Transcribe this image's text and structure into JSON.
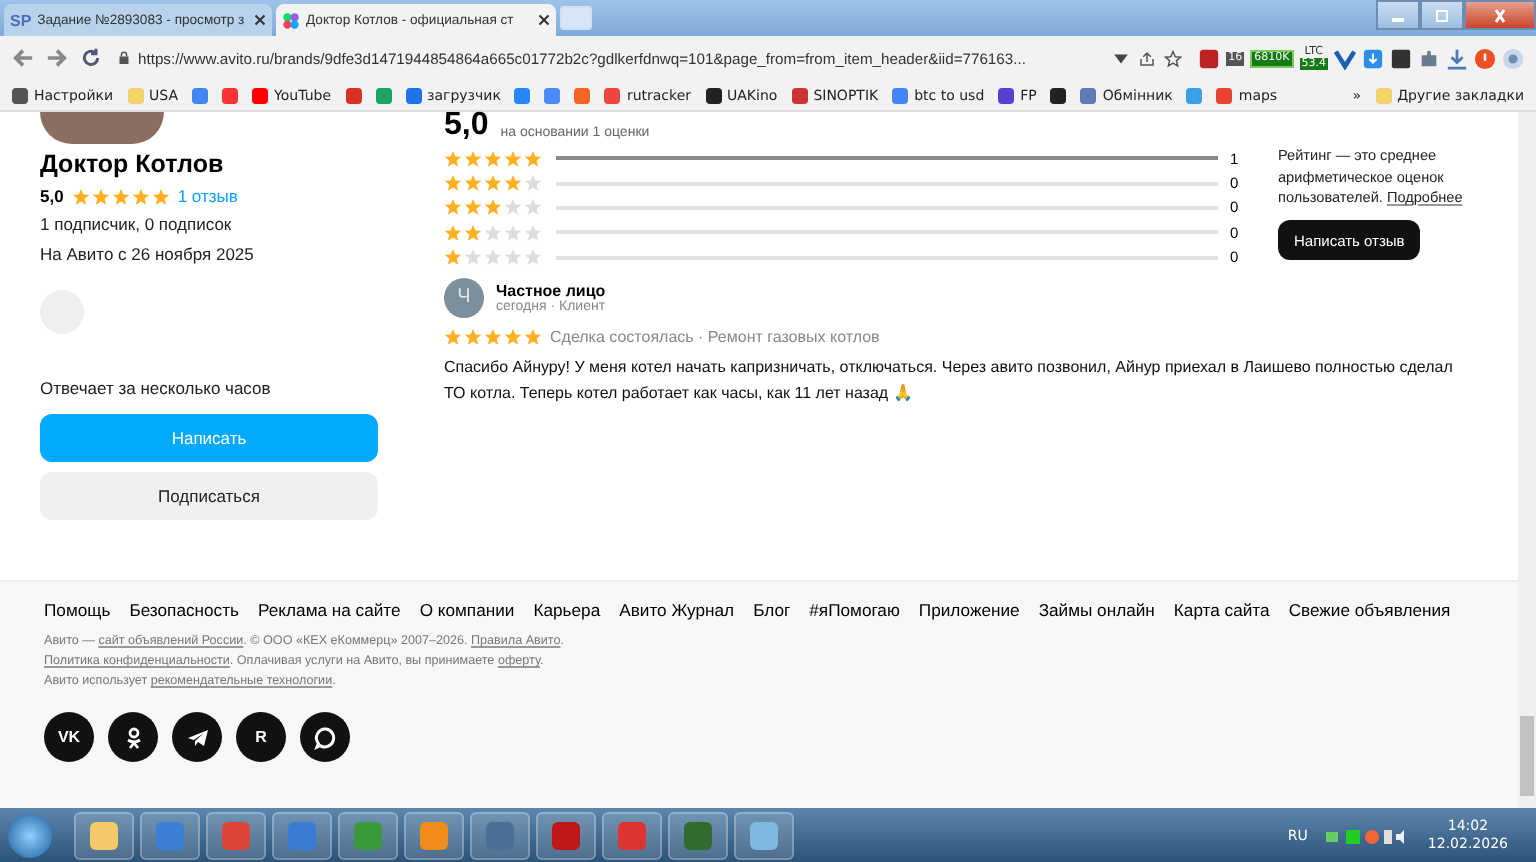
{
  "browser": {
    "tabs": [
      {
        "title": "Задание №2893083 - просмотр з",
        "logo": "SP",
        "selected": false
      },
      {
        "title": "Доктор Котлов - официальная ст",
        "selected": true
      }
    ],
    "url": "https://www.avito.ru/brands/9dfe3d1471944854864a665c01772b2c?gdlkerfdnwq=101&page_from=from_item_header&iid=776163...",
    "extension_badges": [
      {
        "kind": "count",
        "text": "16"
      },
      {
        "kind": "price",
        "text": "6810K"
      },
      {
        "kind": "coin",
        "label": "LTC",
        "text": "53.4"
      }
    ],
    "bookmarks": [
      {
        "kind": "labeled",
        "label": "Настройки"
      },
      {
        "kind": "labeled",
        "label": "USA"
      },
      {
        "kind": "icon"
      },
      {
        "kind": "icon"
      },
      {
        "kind": "labeled",
        "label": "YouTube"
      },
      {
        "kind": "icon"
      },
      {
        "kind": "icon"
      },
      {
        "kind": "labeled",
        "label": "загрузчик"
      },
      {
        "kind": "icon"
      },
      {
        "kind": "icon"
      },
      {
        "kind": "icon"
      },
      {
        "kind": "labeled",
        "label": "rutracker"
      },
      {
        "kind": "labeled",
        "label": "UAKino"
      },
      {
        "kind": "labeled",
        "label": "SINOPTIK"
      },
      {
        "kind": "labeled",
        "label": "btc to usd"
      },
      {
        "kind": "labeled",
        "label": "FP"
      },
      {
        "kind": "icon"
      },
      {
        "kind": "labeled",
        "label": "Обмінник"
      },
      {
        "kind": "icon"
      },
      {
        "kind": "labeled",
        "label": "maps"
      }
    ],
    "bookmarks_more": "»",
    "other_bookmarks": "Другие закладки"
  },
  "profile": {
    "name": "Доктор Котлов",
    "rating": "5,0",
    "stars": 5,
    "reviews_link": "1 отзыв",
    "followers": "1 подписчик, 0 подписок",
    "since": "На Авито с 26 ноября 2025",
    "response_time": "Отвечает за несколько часов",
    "buttons": [
      {
        "label": "Написать",
        "kind": "primary"
      },
      {
        "label": "Подписаться",
        "kind": "secondary"
      }
    ]
  },
  "rating_summary": {
    "score": "5,0",
    "basis": "на основании 1 оценки",
    "rows": [
      {
        "stars": 5,
        "level": 1,
        "count": "1"
      },
      {
        "stars": 4,
        "level": 0,
        "count": "0"
      },
      {
        "stars": 3,
        "level": 0,
        "count": "0"
      },
      {
        "stars": 2,
        "level": 0,
        "count": "0"
      },
      {
        "stars": 1,
        "level": 0,
        "count": "0"
      }
    ],
    "note": "Рейтинг — это среднее арифметическое оценок пользователей.",
    "note_link": "Подробнее",
    "write_review": "Написать отзыв"
  },
  "review": {
    "initial": "Ч",
    "author": "Частное лицо",
    "meta": "сегодня · Клиент",
    "stars": 5,
    "tags": "Сделка состоялась · Ремонт газовых котлов",
    "text": "Спасибо Айнуру! У меня котел начать капризничать, отключаться. Через авито позвонил, Айнур приехал в Лаишево полностью сделал ТО котла. Теперь котел работает как часы, как 11 лет назад 🙏"
  },
  "footer": {
    "links": [
      "Помощь",
      "Безопасность",
      "Реклама на сайте",
      "О компании",
      "Карьера",
      "Авито Журнал",
      "Блог",
      "#яПомогаю",
      "Приложение",
      "Займы онлайн",
      "Карта сайта",
      "Свежие объявления"
    ],
    "legal": [
      [
        {
          "t": "Авито — "
        },
        {
          "t": "сайт объявлений России",
          "link": true
        },
        {
          "t": ". © ООО «КЕХ еКоммерц» 2007–2026. "
        },
        {
          "t": "Правила Авито",
          "link": true
        },
        {
          "t": "."
        }
      ],
      [
        {
          "t": "Политика конфиденциальности",
          "link": true
        },
        {
          "t": ". Оплачивая услуги на Авито, вы принимаете "
        },
        {
          "t": "оферту",
          "link": true
        },
        {
          "t": "."
        }
      ],
      [
        {
          "t": "Авито использует "
        },
        {
          "t": "рекомендательные технологии",
          "link": true
        },
        {
          "t": "."
        }
      ]
    ],
    "socials": [
      {
        "kind": "vk",
        "text": "VK"
      },
      {
        "kind": "ok"
      },
      {
        "kind": "tg"
      },
      {
        "kind": "r",
        "text": "R"
      },
      {
        "kind": "chat"
      }
    ]
  },
  "taskbar": {
    "language": "RU",
    "time": "14:02",
    "date": "12.02.2026"
  }
}
